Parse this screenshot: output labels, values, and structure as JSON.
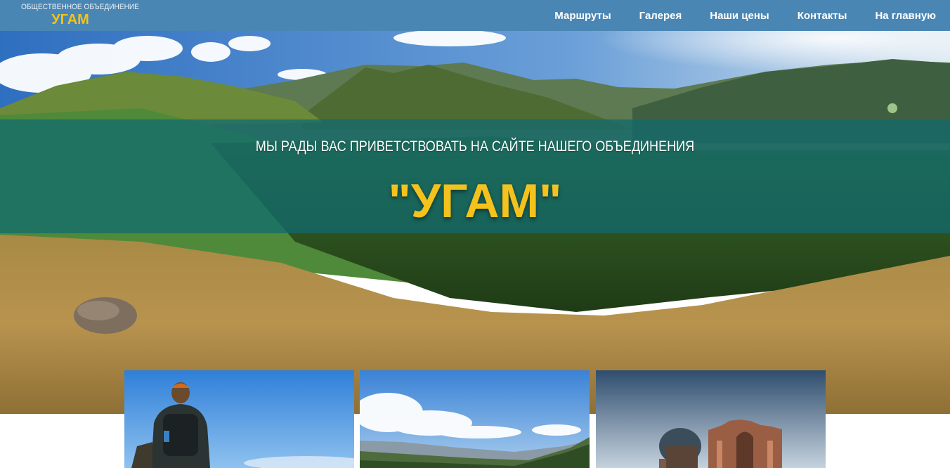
{
  "header": {
    "logo_sub": "ОБЩЕСТВЕННОЕ ОБЪЕДИНЕНИЕ",
    "logo_main": "УГАМ",
    "nav": [
      {
        "label": "Маршруты"
      },
      {
        "label": "Галерея"
      },
      {
        "label": "Наши цены"
      },
      {
        "label": "Контакты"
      },
      {
        "label": "На главную"
      }
    ]
  },
  "hero": {
    "welcome": "МЫ РАДЫ ВАС ПРИВЕТСТВОВАТЬ НА САЙТЕ НАШЕГО ОБЪЕДИНЕНИЯ",
    "brand": "\"УГАМ\""
  },
  "cards": [
    {
      "image": "hiker-photo"
    },
    {
      "image": "mountain-valley-photo"
    },
    {
      "image": "mausoleum-photo"
    }
  ],
  "colors": {
    "header_bg": "#4a86b4",
    "accent_yellow": "#f4c21c",
    "banner_overlay": "rgba(16,105,110,0.74)"
  }
}
